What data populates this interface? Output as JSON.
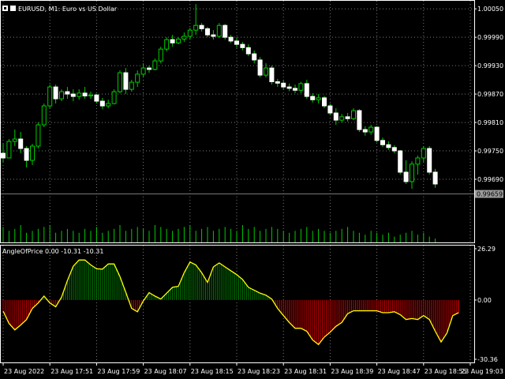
{
  "header": {
    "symbol_title": "EURUSD, M1:  Euro vs US Dollar",
    "indicator_title": "AngleOfPrice 0.00 -10.31 -10.31"
  },
  "colors": {
    "background": "#000000",
    "bull_body": "#000000",
    "bull_outline": "#00cc00",
    "bear_body": "#ffffff",
    "wick": "#00cc00",
    "volume": "#00cc00",
    "angle_line": "#ffff00",
    "hist_positive": "#008000",
    "hist_negative": "#cc0000",
    "grid": "#7a7a7a",
    "bid_line": "#7a7a7a"
  },
  "chart_data": [
    {
      "type": "candlestick",
      "title": "EURUSD, M1:  Euro vs US Dollar",
      "ylim": [
        0.99625,
        1.00062
      ],
      "y_ticks": [
        "1.00050",
        "0.99990",
        "0.99930",
        "0.99870",
        "0.99810",
        "0.99750",
        "0.99690"
      ],
      "y_tick_values": [
        1.0005,
        0.9999,
        0.9993,
        0.9987,
        0.9981,
        0.9975,
        0.9969
      ],
      "current_price_label": "0.99659",
      "current_price": 0.99659,
      "grid": true,
      "ohlc": [
        [
          0.99745,
          0.99765,
          0.99725,
          0.99735
        ],
        [
          0.99735,
          0.99775,
          0.99735,
          0.9977
        ],
        [
          0.9977,
          0.99795,
          0.9976,
          0.99775
        ],
        [
          0.99775,
          0.9979,
          0.99745,
          0.99755
        ],
        [
          0.99755,
          0.9976,
          0.99715,
          0.9973
        ],
        [
          0.9973,
          0.99765,
          0.9972,
          0.9976
        ],
        [
          0.9976,
          0.9981,
          0.99755,
          0.99805
        ],
        [
          0.99805,
          0.9985,
          0.998,
          0.99845
        ],
        [
          0.99845,
          0.9989,
          0.9984,
          0.99885
        ],
        [
          0.99885,
          0.9989,
          0.9985,
          0.9986
        ],
        [
          0.9986,
          0.9988,
          0.99855,
          0.99875
        ],
        [
          0.99875,
          0.99885,
          0.9986,
          0.9987
        ],
        [
          0.9987,
          0.9988,
          0.99855,
          0.99865
        ],
        [
          0.99865,
          0.9988,
          0.99858,
          0.99872
        ],
        [
          0.99872,
          0.99885,
          0.9986,
          0.99866
        ],
        [
          0.99866,
          0.99875,
          0.9986,
          0.99868
        ],
        [
          0.99868,
          0.9987,
          0.9985,
          0.99855
        ],
        [
          0.99855,
          0.99862,
          0.99838,
          0.99845
        ],
        [
          0.99845,
          0.99858,
          0.9984,
          0.9985
        ],
        [
          0.9985,
          0.9988,
          0.99848,
          0.99875
        ],
        [
          0.99875,
          0.9992,
          0.99872,
          0.99915
        ],
        [
          0.99915,
          0.99925,
          0.9987,
          0.9988
        ],
        [
          0.9988,
          0.999,
          0.99875,
          0.99895
        ],
        [
          0.99895,
          0.9992,
          0.99885,
          0.99912
        ],
        [
          0.99912,
          0.99935,
          0.99905,
          0.99925
        ],
        [
          0.99925,
          0.9993,
          0.99915,
          0.99922
        ],
        [
          0.99922,
          0.99945,
          0.9992,
          0.9994
        ],
        [
          0.9994,
          0.9997,
          0.99935,
          0.99965
        ],
        [
          0.99965,
          0.9999,
          0.9996,
          0.99985
        ],
        [
          0.99985,
          0.99995,
          0.9997,
          0.99978
        ],
        [
          0.99978,
          0.9999,
          0.99975,
          0.99986
        ],
        [
          0.99986,
          1.0,
          0.9998,
          0.99992
        ],
        [
          0.99992,
          1.0001,
          0.99985,
          1.00005
        ],
        [
          1.00005,
          1.0006,
          0.99995,
          1.00015
        ],
        [
          1.00015,
          1.0002,
          1.00002,
          1.00008
        ],
        [
          1.00008,
          1.00012,
          0.9999,
          0.99995
        ],
        [
          0.99995,
          1.00005,
          0.99985,
          0.99992
        ],
        [
          0.99992,
          1.0002,
          0.99988,
          1.00015
        ],
        [
          1.00015,
          1.00018,
          0.99985,
          0.9999
        ],
        [
          0.9999,
          0.99995,
          0.99978,
          0.99982
        ],
        [
          0.99982,
          0.9999,
          0.99968,
          0.99975
        ],
        [
          0.99975,
          0.9998,
          0.99962,
          0.99968
        ],
        [
          0.99968,
          0.99975,
          0.9995,
          0.99955
        ],
        [
          0.99955,
          0.99962,
          0.99935,
          0.99942
        ],
        [
          0.99942,
          0.99948,
          0.99905,
          0.9991
        ],
        [
          0.9991,
          0.99935,
          0.99905,
          0.99925
        ],
        [
          0.99925,
          0.9993,
          0.9989,
          0.99896
        ],
        [
          0.99896,
          0.99902,
          0.99885,
          0.99893
        ],
        [
          0.99893,
          0.999,
          0.9988,
          0.99885
        ],
        [
          0.99885,
          0.99892,
          0.99876,
          0.99882
        ],
        [
          0.99882,
          0.9989,
          0.99872,
          0.99878
        ],
        [
          0.99878,
          0.99896,
          0.99872,
          0.99892
        ],
        [
          0.99892,
          0.999,
          0.9986,
          0.99865
        ],
        [
          0.99865,
          0.99872,
          0.99852,
          0.99858
        ],
        [
          0.99858,
          0.9987,
          0.9985,
          0.99862
        ],
        [
          0.99862,
          0.99866,
          0.9984,
          0.99845
        ],
        [
          0.99845,
          0.9985,
          0.99825,
          0.9983
        ],
        [
          0.9983,
          0.9984,
          0.99805,
          0.99815
        ],
        [
          0.99815,
          0.99828,
          0.9981,
          0.99822
        ],
        [
          0.99822,
          0.9983,
          0.99812,
          0.99818
        ],
        [
          0.99818,
          0.9984,
          0.99815,
          0.99835
        ],
        [
          0.99835,
          0.99838,
          0.9979,
          0.99795
        ],
        [
          0.99795,
          0.99802,
          0.99782,
          0.9979
        ],
        [
          0.9979,
          0.99805,
          0.99784,
          0.998
        ],
        [
          0.998,
          0.99802,
          0.99768,
          0.99772
        ],
        [
          0.99772,
          0.99778,
          0.99758,
          0.99763
        ],
        [
          0.99763,
          0.9977,
          0.99752,
          0.99757
        ],
        [
          0.99757,
          0.99762,
          0.99745,
          0.9975
        ],
        [
          0.9975,
          0.99752,
          0.997,
          0.99705
        ],
        [
          0.99705,
          0.9973,
          0.9968,
          0.99685
        ],
        [
          0.99685,
          0.99728,
          0.9967,
          0.99722
        ],
        [
          0.99722,
          0.9974,
          0.997,
          0.99735
        ],
        [
          0.99735,
          0.9976,
          0.99725,
          0.99755
        ],
        [
          0.99755,
          0.9976,
          0.997,
          0.99705
        ],
        [
          0.99705,
          0.99712,
          0.99672,
          0.9968
        ]
      ]
    },
    {
      "type": "bar",
      "title": "",
      "series": [
        {
          "values": [
            8,
            6,
            7,
            9,
            5,
            6,
            7,
            8,
            9,
            5,
            6,
            7,
            6,
            5,
            7,
            6,
            8,
            5,
            6,
            7,
            9,
            6,
            7,
            8,
            7,
            6,
            9,
            8,
            7,
            6,
            7,
            8,
            9,
            6,
            7,
            8,
            6,
            7,
            8,
            7,
            6,
            9,
            7,
            8,
            6,
            7,
            8,
            7,
            6,
            5,
            6,
            7,
            8,
            6,
            7,
            6,
            5,
            6,
            7,
            8,
            6,
            5,
            4,
            6,
            5,
            4,
            5,
            3,
            4,
            5,
            6,
            4,
            5,
            3,
            2
          ]
        }
      ]
    },
    {
      "type": "line",
      "title": "AngleOfPrice 0.00 -10.31 -10.31",
      "ylim": [
        -30.36,
        26.29
      ],
      "y_ticks": [
        "26.29",
        "0.00",
        "-30.36"
      ],
      "y_tick_values": [
        26.29,
        0.0,
        -30.36
      ],
      "x_tick_labels": [
        "23 Aug 2022",
        "23 Aug 17:51",
        "23 Aug 17:59",
        "23 Aug 18:07",
        "23 Aug 18:15",
        "23 Aug 18:23",
        "23 Aug 18:31",
        "23 Aug 18:39",
        "23 Aug 18:47",
        "23 Aug 18:55",
        "23 Aug 19:03"
      ],
      "x_tick_index": [
        0,
        8,
        16,
        24,
        32,
        40,
        48,
        56,
        64,
        72,
        80
      ],
      "series": [
        {
          "values": [
            -5.7,
            -12.0,
            -15.3,
            -12.8,
            -10.0,
            -4.3,
            -1.5,
            2.0,
            -1.5,
            -3.5,
            1.5,
            10.0,
            17.3,
            20.5,
            20.5,
            18.0,
            16.0,
            15.8,
            18.5,
            18.5,
            12.0,
            4.0,
            -4.3,
            -6.0,
            -0.5,
            3.8,
            2.0,
            0.5,
            3.5,
            6.5,
            7.0,
            14.0,
            19.5,
            18.0,
            14.0,
            9.0,
            17.0,
            19.0,
            17.0,
            15.0,
            13.0,
            10.5,
            6.5,
            5.0,
            3.5,
            2.5,
            0.5,
            -4.3,
            -8.0,
            -11.5,
            -14.5,
            -14.5,
            -16.0,
            -20.5,
            -22.8,
            -19.0,
            -16.5,
            -13.5,
            -11.5,
            -7.0,
            -5.5,
            -5.5,
            -5.5,
            -5.5,
            -5.5,
            -6.5,
            -6.5,
            -6.0,
            -7.5,
            -10.0,
            -9.5,
            -10.0,
            -8.0,
            -10.0,
            -16.0,
            -21.5,
            -17.0,
            -8.0,
            -6.5
          ]
        }
      ]
    }
  ]
}
